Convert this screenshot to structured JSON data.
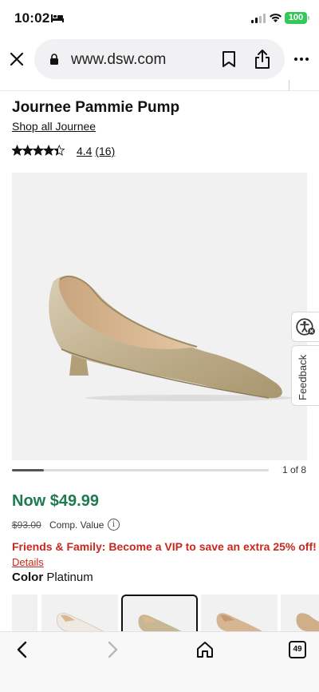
{
  "status_bar": {
    "time": "10:02",
    "battery": "100"
  },
  "browser": {
    "url": "www.dsw.com",
    "tab_count": "49"
  },
  "product": {
    "title": "Journee Pammie Pump",
    "brand_link": "Shop all Journee",
    "rating_value": "4.4",
    "review_count": "(16)",
    "rating_stars": 4.4,
    "image_page": "1 of 8",
    "image_progress_fraction": 0.125,
    "now_price": "Now $49.99",
    "old_price": "$93.00",
    "comp_label": "Comp. Value",
    "promo": "Friends & Family: Become a VIP to save an extra 25% off!",
    "details_link": "Details",
    "color_label": "Color",
    "color_value": "Platinum"
  },
  "side_tabs": {
    "feedback": "Feedback"
  },
  "colors": {
    "price_green": "#1f7a52",
    "promo_red": "#c8281e",
    "battery_green": "#34c759"
  }
}
